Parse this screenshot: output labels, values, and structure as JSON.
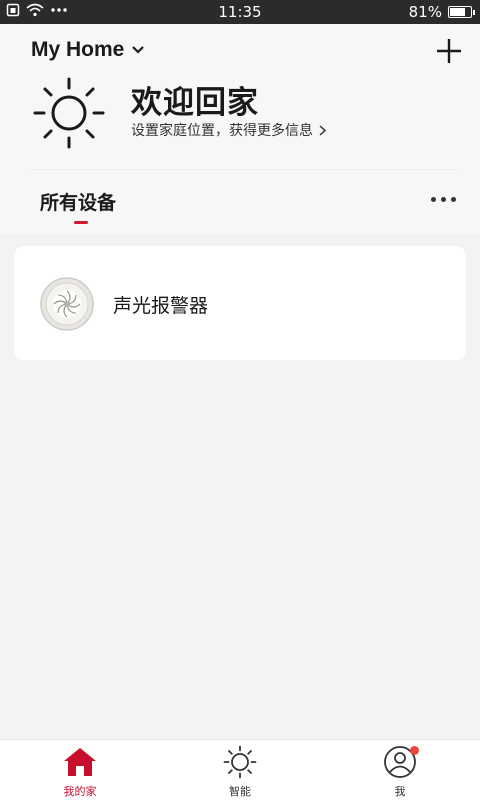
{
  "status_bar": {
    "time": "11:35",
    "battery_text": "81%",
    "battery_level": 0.81,
    "icons": [
      "sim-icon",
      "wifi-icon",
      "more-dots-icon",
      "battery-icon"
    ]
  },
  "header": {
    "home_name": "My Home",
    "welcome_title": "欢迎回家",
    "welcome_subtitle": "设置家庭位置，获得更多信息",
    "icons": [
      "chevron-down-icon",
      "plus-icon",
      "sun-icon",
      "chevron-right-icon"
    ]
  },
  "tabs": {
    "all_devices_label": "所有设备",
    "indicator_color": "#d0192c"
  },
  "devices": [
    {
      "name": "声光报警器",
      "icon": "sound-light-alarm-icon"
    }
  ],
  "bottom_nav": {
    "items": [
      {
        "label": "我的家",
        "icon": "home-icon",
        "active": true
      },
      {
        "label": "智能",
        "icon": "sun-icon",
        "active": false
      },
      {
        "label": "我",
        "icon": "profile-icon",
        "active": false,
        "badge": true
      }
    ],
    "active_color": "#c8102e",
    "badge_color": "#e8453c"
  }
}
